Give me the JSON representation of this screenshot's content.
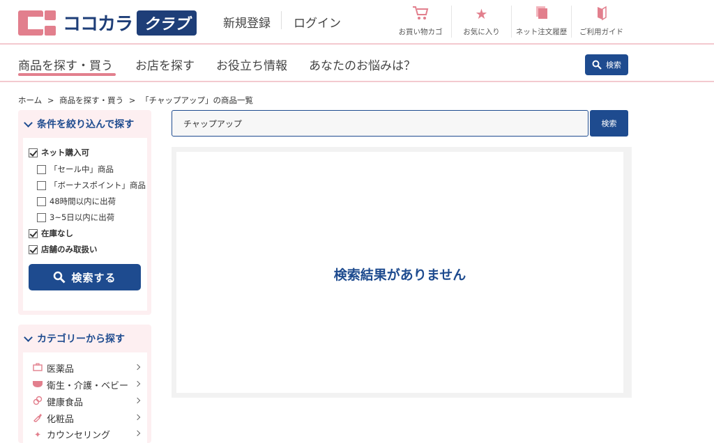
{
  "header": {
    "logo_text": "ココカラ",
    "logo_badge": "クラブ",
    "register": "新規登録",
    "login": "ログイン",
    "utilities": [
      {
        "icon": "cart-icon",
        "label": "お買い物カゴ"
      },
      {
        "icon": "star-icon",
        "label": "お気に入り"
      },
      {
        "icon": "history-icon",
        "label": "ネット注文履歴"
      },
      {
        "icon": "book-icon",
        "label": "ご利用ガイド"
      }
    ]
  },
  "nav": {
    "items": [
      "商品を探す・買う",
      "お店を探す",
      "お役立ち情報",
      "あなたのお悩みは？"
    ],
    "search_label": "検索"
  },
  "breadcrumb": [
    "ホーム",
    ">",
    "商品を探す・買う",
    ">",
    "「チャップアップ」の商品一覧"
  ],
  "filter": {
    "title": "条件を絞り込んで探す",
    "options": [
      {
        "label": "ネット購入可",
        "checked": true,
        "bold": true
      },
      {
        "label": "「セール中」商品",
        "checked": false,
        "bold": false
      },
      {
        "label": "「ボーナスポイント」商品",
        "checked": false,
        "bold": false
      },
      {
        "label": "48時間以内に出荷",
        "checked": false,
        "bold": false
      },
      {
        "label": "3~5日以内に出荷",
        "checked": false,
        "bold": false
      },
      {
        "label": "在庫なし",
        "checked": true,
        "bold": true
      },
      {
        "label": "店舗のみ取扱い",
        "checked": true,
        "bold": true
      }
    ],
    "button": "検索する"
  },
  "category": {
    "title": "カテゴリーから探す",
    "items": [
      {
        "icon": "medicine-box-icon",
        "label": "医薬品"
      },
      {
        "icon": "diaper-icon",
        "label": "衛生・介護・ベビー"
      },
      {
        "icon": "supplement-icon",
        "label": "健康食品"
      },
      {
        "icon": "lipstick-icon",
        "label": "化粧品"
      },
      {
        "icon": "sparkle-icon",
        "label": "カウンセリング"
      }
    ]
  },
  "search": {
    "value": "チャップアップ",
    "button": "検索"
  },
  "results": {
    "message": "検索結果がありません"
  },
  "colors": {
    "brand_blue": "#1e4b8f",
    "brand_pink": "#e27f8d",
    "panel_pink": "#fdeff1"
  }
}
